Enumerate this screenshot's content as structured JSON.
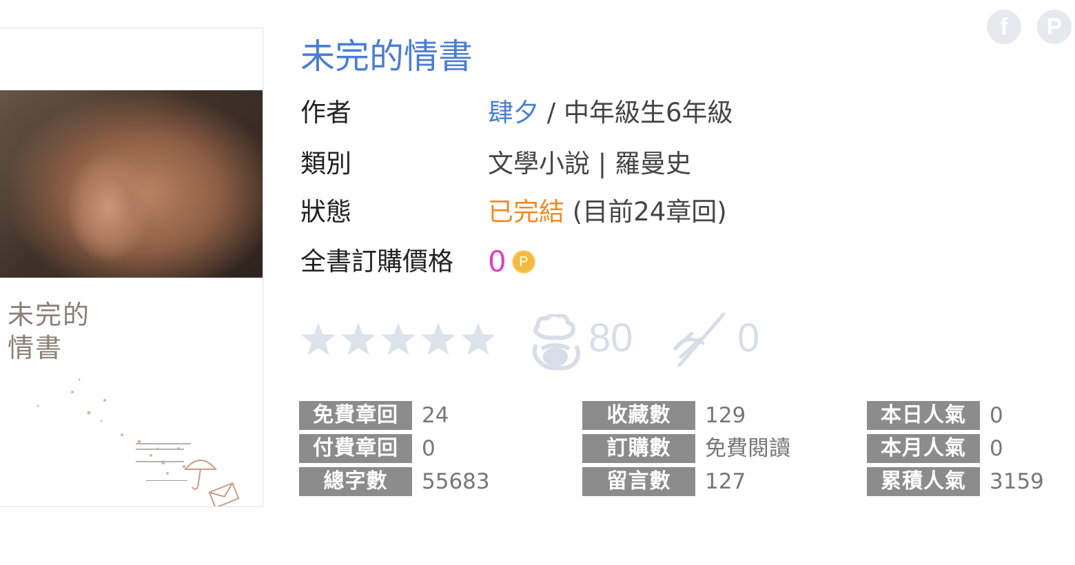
{
  "book": {
    "title": "未完的情書"
  },
  "cover": {
    "title_line1": "未完的",
    "title_line2": "情書"
  },
  "info": {
    "author_label": "作者",
    "author_name": "肆夕",
    "author_sep": " / ",
    "author_grade": "中年級生6年級",
    "category_label": "類別",
    "category_value": "文學小說 | 羅曼史",
    "status_label": "狀態",
    "status_done": "已完結",
    "status_detail": " (目前24章回)",
    "price_label": "全書訂購價格",
    "price_value": "0",
    "coin_letter": "P"
  },
  "social": {
    "facebook_icon": "f",
    "plurk_icon": "P"
  },
  "ratings": {
    "stars": 0,
    "max_stars": 5,
    "likes": "80",
    "dislikes": "0"
  },
  "stats": {
    "free_chapters_label": "免費章回",
    "free_chapters": "24",
    "paid_chapters_label": "付費章回",
    "paid_chapters": "0",
    "word_count_label": "總字數",
    "word_count": "55683",
    "favorites_label": "收藏數",
    "favorites": "129",
    "orders_label": "訂購數",
    "orders": "免費閱讀",
    "comments_label": "留言數",
    "comments": "127",
    "today_label": "本日人氣",
    "today": "0",
    "month_label": "本月人氣",
    "month": "0",
    "total_label": "累積人氣",
    "total": "3159"
  },
  "colors": {
    "title": "#4a7ed3",
    "status_done": "#f08a24",
    "price": "#e040c0",
    "label_bg": "#8c8c8c",
    "inactive": "#d7dee8"
  }
}
